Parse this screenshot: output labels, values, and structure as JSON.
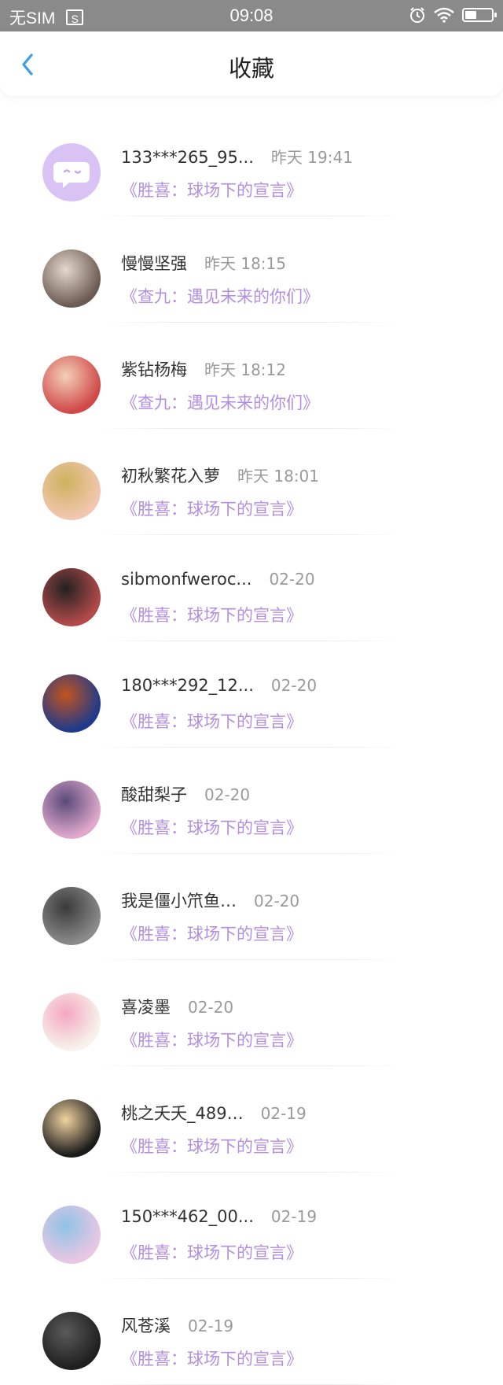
{
  "status_bar": {
    "carrier": "无SIM",
    "time": "09:08"
  },
  "header": {
    "title": "收藏"
  },
  "items": [
    {
      "name": "133***265_95...",
      "time": "昨天 19:41",
      "work": "《胜喜：球场下的宣言》",
      "avatar_icon": "chat-bubble-avatar-icon",
      "avatar_colors": [
        "#d9c3f5",
        "#c9a9ef"
      ]
    },
    {
      "name": "慢慢坚强",
      "time": "昨天 18:15",
      "work": "《查九：遇见未来的你们》",
      "avatar_icon": "anime-girl-avatar",
      "avatar_colors": [
        "#6b5b52",
        "#e6d7cc"
      ]
    },
    {
      "name": "紫钻杨梅",
      "time": "昨天 18:12",
      "work": "《查九：遇见未来的你们》",
      "avatar_icon": "anime-girl-red-avatar",
      "avatar_colors": [
        "#d04848",
        "#f3d0b8"
      ]
    },
    {
      "name": "初秋繁花入萝",
      "time": "昨天 18:01",
      "work": "《胜喜：球场下的宣言》",
      "avatar_icon": "anime-girl-pink-avatar",
      "avatar_colors": [
        "#f2c7b0",
        "#cdb25e"
      ]
    },
    {
      "name": "sibmonfweroc...",
      "time": "02-20",
      "work": "《胜喜：球场下的宣言》",
      "avatar_icon": "panda-avatar",
      "avatar_colors": [
        "#b34a4a",
        "#222222"
      ]
    },
    {
      "name": "180***292_12...",
      "time": "02-20",
      "work": "《胜喜：球场下的宣言》",
      "avatar_icon": "boy-blue-avatar",
      "avatar_colors": [
        "#1e3a8a",
        "#c2541f"
      ]
    },
    {
      "name": "酸甜梨子",
      "time": "02-20",
      "work": "《胜喜：球场下的宣言》",
      "avatar_icon": "sunset-pier-avatar",
      "avatar_colors": [
        "#e0a9cc",
        "#5a4a7a"
      ]
    },
    {
      "name": "我是僵小笊鱼…",
      "time": "02-20",
      "work": "《胜喜：球场下的宣言》",
      "avatar_icon": "girl-photo-avatar",
      "avatar_colors": [
        "#8a8a8a",
        "#3a3a3a"
      ]
    },
    {
      "name": "喜凌墨",
      "time": "02-20",
      "work": "《胜喜：球场下的宣言》",
      "avatar_icon": "sheep-avatar",
      "avatar_colors": [
        "#f7f3ec",
        "#f4a7c1"
      ]
    },
    {
      "name": "桃之夭夭_489…",
      "time": "02-19",
      "work": "《胜喜：球场下的宣言》",
      "avatar_icon": "anime-blonde-avatar",
      "avatar_colors": [
        "#1a1a1a",
        "#f0d3a0"
      ]
    },
    {
      "name": "150***462_00...",
      "time": "02-19",
      "work": "《胜喜：球场下的宣言》",
      "avatar_icon": "abstract-circle-avatar",
      "avatar_colors": [
        "#e9c7e3",
        "#8fc3e6"
      ]
    },
    {
      "name": "风苍溪",
      "time": "02-19",
      "work": "《胜喜：球场下的宣言》",
      "avatar_icon": "dark-figure-avatar",
      "avatar_colors": [
        "#1f1f1f",
        "#5a5a5a"
      ]
    }
  ],
  "colors": {
    "accent_work": "#b38fe0",
    "back_arrow": "#3aa0e6",
    "status_bar_bg": "#8a8a8a"
  }
}
